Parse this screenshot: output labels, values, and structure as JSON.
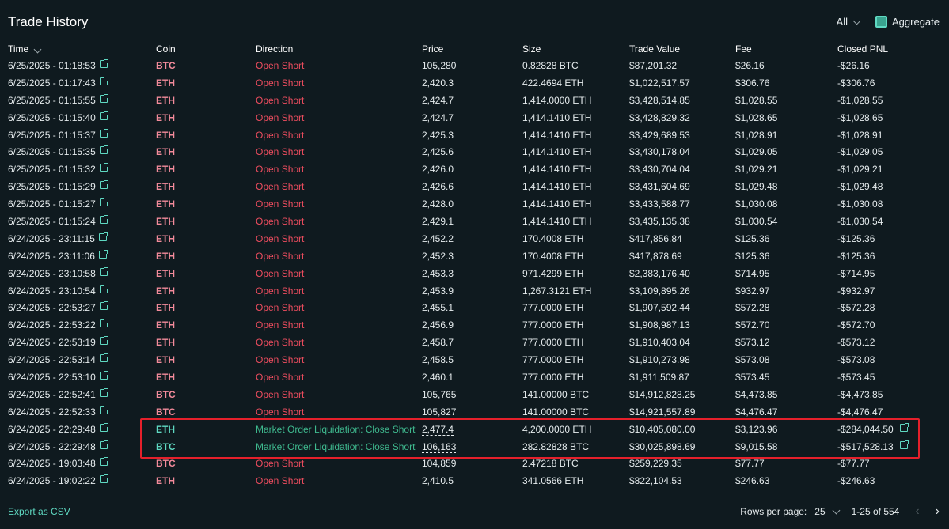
{
  "title": "Trade History",
  "filters": {
    "all_label": "All",
    "aggregate_label": "Aggregate"
  },
  "columns": [
    "Time",
    "Coin",
    "Direction",
    "Price",
    "Size",
    "Trade Value",
    "Fee",
    "Closed PNL"
  ],
  "rows": [
    {
      "time": "6/25/2025 - 01:18:53",
      "coin": "BTC",
      "direction": "Open Short",
      "price": "105,280",
      "size": "0.82828 BTC",
      "value": "$87,201.32",
      "fee": "$26.16",
      "pnl": "-$26.16"
    },
    {
      "time": "6/25/2025 - 01:17:43",
      "coin": "ETH",
      "direction": "Open Short",
      "price": "2,420.3",
      "size": "422.4694 ETH",
      "value": "$1,022,517.57",
      "fee": "$306.76",
      "pnl": "-$306.76"
    },
    {
      "time": "6/25/2025 - 01:15:55",
      "coin": "ETH",
      "direction": "Open Short",
      "price": "2,424.7",
      "size": "1,414.0000 ETH",
      "value": "$3,428,514.85",
      "fee": "$1,028.55",
      "pnl": "-$1,028.55"
    },
    {
      "time": "6/25/2025 - 01:15:40",
      "coin": "ETH",
      "direction": "Open Short",
      "price": "2,424.7",
      "size": "1,414.1410 ETH",
      "value": "$3,428,829.32",
      "fee": "$1,028.65",
      "pnl": "-$1,028.65"
    },
    {
      "time": "6/25/2025 - 01:15:37",
      "coin": "ETH",
      "direction": "Open Short",
      "price": "2,425.3",
      "size": "1,414.1410 ETH",
      "value": "$3,429,689.53",
      "fee": "$1,028.91",
      "pnl": "-$1,028.91"
    },
    {
      "time": "6/25/2025 - 01:15:35",
      "coin": "ETH",
      "direction": "Open Short",
      "price": "2,425.6",
      "size": "1,414.1410 ETH",
      "value": "$3,430,178.04",
      "fee": "$1,029.05",
      "pnl": "-$1,029.05"
    },
    {
      "time": "6/25/2025 - 01:15:32",
      "coin": "ETH",
      "direction": "Open Short",
      "price": "2,426.0",
      "size": "1,414.1410 ETH",
      "value": "$3,430,704.04",
      "fee": "$1,029.21",
      "pnl": "-$1,029.21"
    },
    {
      "time": "6/25/2025 - 01:15:29",
      "coin": "ETH",
      "direction": "Open Short",
      "price": "2,426.6",
      "size": "1,414.1410 ETH",
      "value": "$3,431,604.69",
      "fee": "$1,029.48",
      "pnl": "-$1,029.48"
    },
    {
      "time": "6/25/2025 - 01:15:27",
      "coin": "ETH",
      "direction": "Open Short",
      "price": "2,428.0",
      "size": "1,414.1410 ETH",
      "value": "$3,433,588.77",
      "fee": "$1,030.08",
      "pnl": "-$1,030.08"
    },
    {
      "time": "6/25/2025 - 01:15:24",
      "coin": "ETH",
      "direction": "Open Short",
      "price": "2,429.1",
      "size": "1,414.1410 ETH",
      "value": "$3,435,135.38",
      "fee": "$1,030.54",
      "pnl": "-$1,030.54"
    },
    {
      "time": "6/24/2025 - 23:11:15",
      "coin": "ETH",
      "direction": "Open Short",
      "price": "2,452.2",
      "size": "170.4008 ETH",
      "value": "$417,856.84",
      "fee": "$125.36",
      "pnl": "-$125.36"
    },
    {
      "time": "6/24/2025 - 23:11:06",
      "coin": "ETH",
      "direction": "Open Short",
      "price": "2,452.3",
      "size": "170.4008 ETH",
      "value": "$417,878.69",
      "fee": "$125.36",
      "pnl": "-$125.36"
    },
    {
      "time": "6/24/2025 - 23:10:58",
      "coin": "ETH",
      "direction": "Open Short",
      "price": "2,453.3",
      "size": "971.4299 ETH",
      "value": "$2,383,176.40",
      "fee": "$714.95",
      "pnl": "-$714.95"
    },
    {
      "time": "6/24/2025 - 23:10:54",
      "coin": "ETH",
      "direction": "Open Short",
      "price": "2,453.9",
      "size": "1,267.3121 ETH",
      "value": "$3,109,895.26",
      "fee": "$932.97",
      "pnl": "-$932.97"
    },
    {
      "time": "6/24/2025 - 22:53:27",
      "coin": "ETH",
      "direction": "Open Short",
      "price": "2,455.1",
      "size": "777.0000 ETH",
      "value": "$1,907,592.44",
      "fee": "$572.28",
      "pnl": "-$572.28"
    },
    {
      "time": "6/24/2025 - 22:53:22",
      "coin": "ETH",
      "direction": "Open Short",
      "price": "2,456.9",
      "size": "777.0000 ETH",
      "value": "$1,908,987.13",
      "fee": "$572.70",
      "pnl": "-$572.70"
    },
    {
      "time": "6/24/2025 - 22:53:19",
      "coin": "ETH",
      "direction": "Open Short",
      "price": "2,458.7",
      "size": "777.0000 ETH",
      "value": "$1,910,403.04",
      "fee": "$573.12",
      "pnl": "-$573.12"
    },
    {
      "time": "6/24/2025 - 22:53:14",
      "coin": "ETH",
      "direction": "Open Short",
      "price": "2,458.5",
      "size": "777.0000 ETH",
      "value": "$1,910,273.98",
      "fee": "$573.08",
      "pnl": "-$573.08"
    },
    {
      "time": "6/24/2025 - 22:53:10",
      "coin": "ETH",
      "direction": "Open Short",
      "price": "2,460.1",
      "size": "777.0000 ETH",
      "value": "$1,911,509.87",
      "fee": "$573.45",
      "pnl": "-$573.45"
    },
    {
      "time": "6/24/2025 - 22:52:41",
      "coin": "BTC",
      "direction": "Open Short",
      "price": "105,765",
      "size": "141.00000 BTC",
      "value": "$14,912,828.25",
      "fee": "$4,473.85",
      "pnl": "-$4,473.85"
    },
    {
      "time": "6/24/2025 - 22:52:33",
      "coin": "BTC",
      "direction": "Open Short",
      "price": "105,827",
      "size": "141.00000 BTC",
      "value": "$14,921,557.89",
      "fee": "$4,476.47",
      "pnl": "-$4,476.47"
    },
    {
      "time": "6/24/2025 - 22:29:48",
      "coin": "ETH",
      "direction": "Market Order Liquidation: Close Short",
      "price": "2,477.4",
      "size": "4,200.0000 ETH",
      "value": "$10,405,080.00",
      "fee": "$3,123.96",
      "pnl": "-$284,044.50",
      "liq": true
    },
    {
      "time": "6/24/2025 - 22:29:48",
      "coin": "BTC",
      "direction": "Market Order Liquidation: Close Short",
      "price": "106,163",
      "size": "282.82828 BTC",
      "value": "$30,025,898.69",
      "fee": "$9,015.58",
      "pnl": "-$517,528.13",
      "liq": true
    },
    {
      "time": "6/24/2025 - 19:03:48",
      "coin": "BTC",
      "direction": "Open Short",
      "price": "104,859",
      "size": "2.47218 BTC",
      "value": "$259,229.35",
      "fee": "$77.77",
      "pnl": "-$77.77"
    },
    {
      "time": "6/24/2025 - 19:02:22",
      "coin": "ETH",
      "direction": "Open Short",
      "price": "2,410.5",
      "size": "341.0566 ETH",
      "value": "$822,104.53",
      "fee": "$246.63",
      "pnl": "-$246.63"
    }
  ],
  "footer": {
    "export_label": "Export as CSV",
    "rows_per_page_label": "Rows per page:",
    "rows_per_page_value": "25",
    "range_label": "1-25 of 554"
  },
  "colors": {
    "background": "#0f1a1f",
    "accent": "#5fd9c2",
    "short_red": "#ee4d5f",
    "highlight_box": "#e5202b"
  }
}
